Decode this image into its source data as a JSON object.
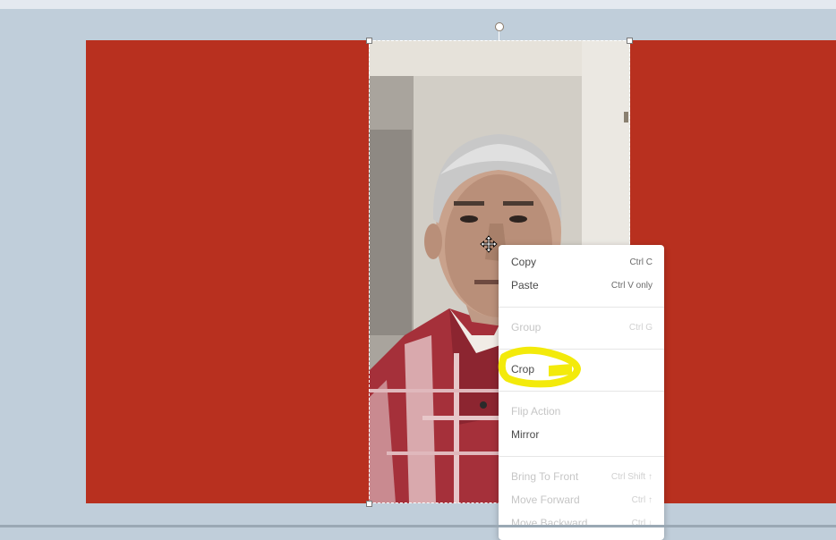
{
  "context_menu": {
    "items": [
      {
        "label": "Copy",
        "shortcut": "Ctrl C",
        "enabled": true
      },
      {
        "label": "Paste",
        "shortcut": "Ctrl V only",
        "enabled": true
      },
      {
        "label": "Group",
        "shortcut": "Ctrl G",
        "enabled": false
      },
      {
        "label": "Crop",
        "shortcut": "",
        "enabled": true,
        "highlighted": true
      },
      {
        "label": "Flip Action",
        "shortcut": "",
        "enabled": false
      },
      {
        "label": "Mirror",
        "shortcut": "",
        "enabled": true
      },
      {
        "label": "Bring To Front",
        "shortcut": "Ctrl Shift ↑",
        "enabled": false
      },
      {
        "label": "Move Forward",
        "shortcut": "Ctrl ↑",
        "enabled": false
      },
      {
        "label": "Move Backward",
        "shortcut": "Ctrl ↓",
        "enabled": false
      }
    ]
  },
  "colors": {
    "slide_background": "#b8301f",
    "workspace": "#c0ceda",
    "highlight_marker": "#f3ea0b"
  },
  "icons": {
    "cursor": "move-cursor-icon"
  }
}
